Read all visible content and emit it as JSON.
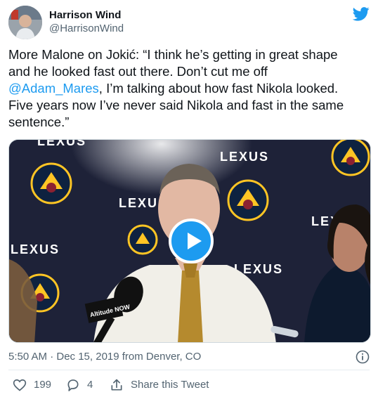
{
  "author": {
    "display_name": "Harrison Wind",
    "handle": "@HarrisonWind"
  },
  "tweet": {
    "lines": [
      "More Malone on Jokić: “I think he’s getting in great shape",
      "and he looked fast out there. Don’t cut me off"
    ],
    "mention": "@Adam_Mares",
    "after_mention": ", I’m talking about how fast Nikola looked.",
    "lines_after": [
      "Five years now I’ve never said Nikola and fast in the same",
      "sentence.”"
    ]
  },
  "media": {
    "backdrop_text": "LEXUS",
    "mic_text": "Altitude NOW"
  },
  "meta": {
    "timestamp": "5:50 AM · Dec 15, 2019 from Denver, CO"
  },
  "actions": {
    "likes": "199",
    "replies": "4",
    "share_label": "Share this Tweet"
  },
  "colors": {
    "accent": "#1d9bf0",
    "text": "#0f1419",
    "secondary": "#536471"
  },
  "icons": [
    "twitter-bird-icon",
    "play-icon",
    "info-icon",
    "heart-icon",
    "reply-icon",
    "share-icon"
  ]
}
